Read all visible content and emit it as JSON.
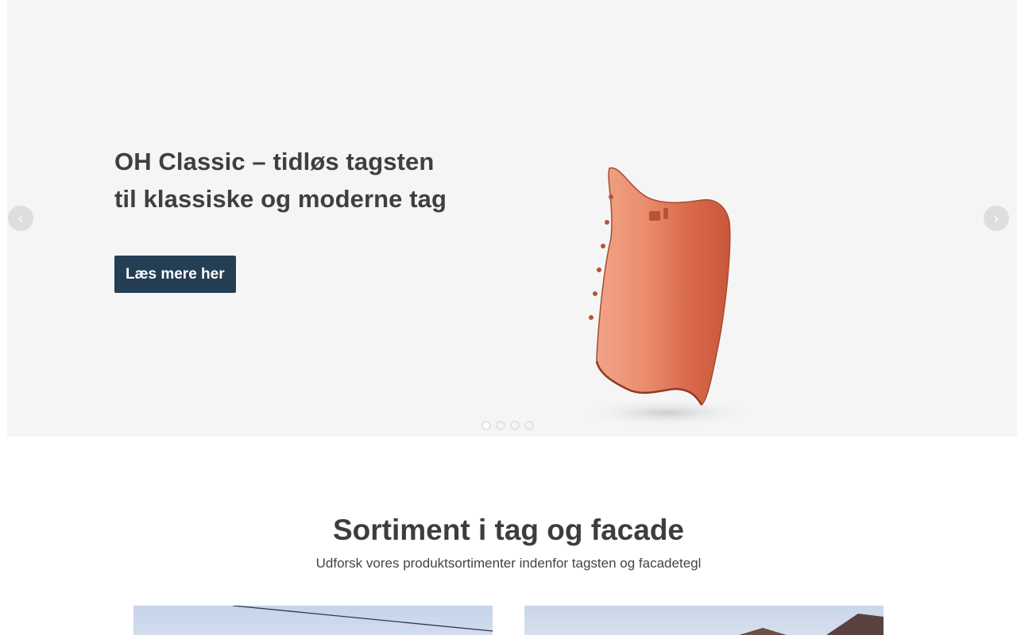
{
  "hero": {
    "title_line1": "OH Classic – tidløs tagsten",
    "title_line2": "til klassiske og moderne tag",
    "cta_label": "Læs mere her",
    "prev_icon": "‹",
    "next_icon": "›",
    "slide_count": 4,
    "active_slide": 1,
    "product_image": "roof-tile-image",
    "colors": {
      "background": "#f5f5f5",
      "button": "#243e54",
      "tile": "#e07a58"
    }
  },
  "assortment": {
    "title": "Sortiment i tag og facade",
    "subtitle": "Udforsk vores produktsortimenter indenfor tagsten og facadetegl"
  }
}
